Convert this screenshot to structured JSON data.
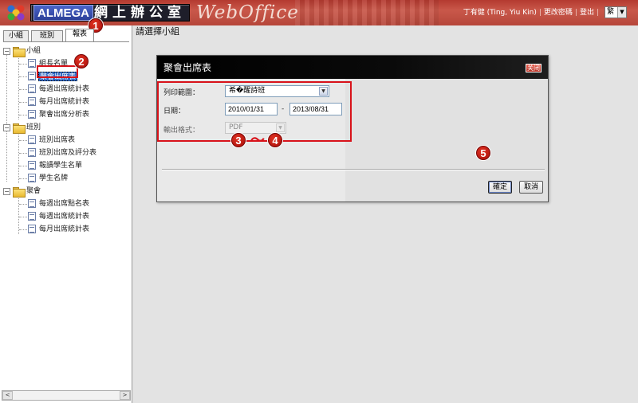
{
  "header": {
    "brand_latin": "ALMEGA",
    "brand_cjk": "網上辦公室",
    "brand_script": "WebOffice",
    "user_name": "丁有健 (Ting, Yiu Kin)",
    "link_change_password": "更改密碼",
    "link_logout": "登出",
    "separator": "|",
    "language_value": "繁",
    "colors": {
      "header_red": "#b43a30",
      "brand_blue": "#2b3f98"
    }
  },
  "sidebar": {
    "tabs": [
      {
        "label": "小組",
        "active": false
      },
      {
        "label": "班別",
        "active": false
      },
      {
        "label": "報表",
        "active": true
      }
    ],
    "tree": [
      {
        "label": "小組",
        "type": "folder",
        "expanded": true,
        "toggle": "−"
      },
      {
        "label": "組長名單",
        "type": "doc"
      },
      {
        "label": "聚會出席表",
        "type": "doc",
        "selected": true
      },
      {
        "label": "每週出席統計表",
        "type": "doc"
      },
      {
        "label": "每月出席統計表",
        "type": "doc"
      },
      {
        "label": "聚會出席分析表",
        "type": "doc"
      },
      {
        "label": "班別",
        "type": "folder",
        "expanded": true,
        "toggle": "−"
      },
      {
        "label": "班別出席表",
        "type": "doc"
      },
      {
        "label": "班別出席及評分表",
        "type": "doc"
      },
      {
        "label": "報讀學生名單",
        "type": "doc"
      },
      {
        "label": "學生名牌",
        "type": "doc"
      },
      {
        "label": "聚會",
        "type": "folder",
        "expanded": true,
        "toggle": "−"
      },
      {
        "label": "每週出席點名表",
        "type": "doc"
      },
      {
        "label": "每週出席統計表",
        "type": "doc"
      },
      {
        "label": "每月出席統計表",
        "type": "doc"
      }
    ],
    "scroll_left": "<",
    "scroll_right": ">"
  },
  "main": {
    "title": "請選擇小組"
  },
  "dialog": {
    "title": "聚會出席表",
    "close_label": "关闭",
    "fields": {
      "range_label": "列印範圍：",
      "range_value": "希�醒詩班",
      "date_label": "日期：",
      "date_from": "2010/01/31",
      "date_separator": "-",
      "date_to": "2013/08/31",
      "format_label": "輸出格式：",
      "format_value": "PDF"
    },
    "ok_label": "確定",
    "cancel_label": "取消"
  },
  "annotations": {
    "step1": "1",
    "step2": "2",
    "step3": "3",
    "step4": "4",
    "step5": "5",
    "range_mark": "～",
    "color": "#d8121a"
  }
}
